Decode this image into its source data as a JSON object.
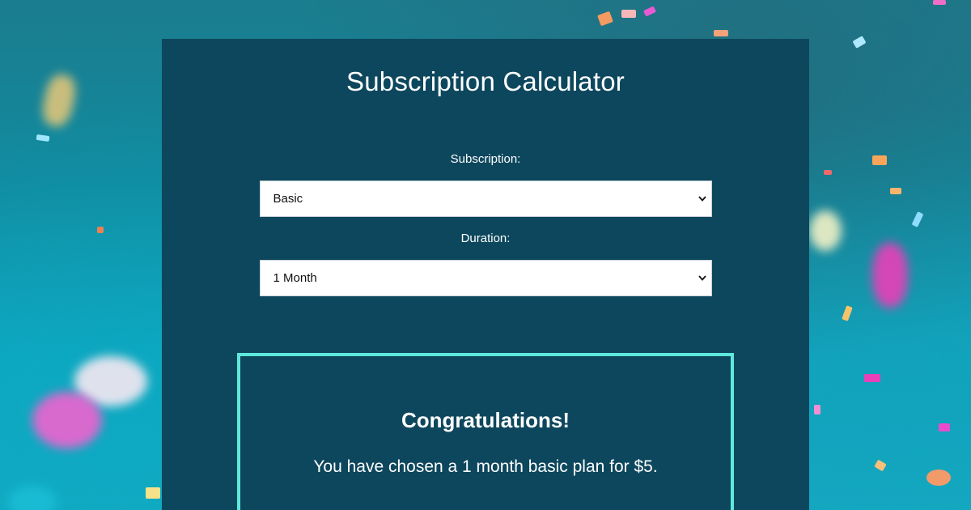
{
  "page": {
    "title": "Subscription Calculator"
  },
  "form": {
    "subscription_label": "Subscription:",
    "subscription_value": "Basic",
    "duration_label": "Duration:",
    "duration_value": "1 Month"
  },
  "result": {
    "heading": "Congratulations!",
    "message": "You have chosen a 1 month basic plan for $5."
  },
  "colors": {
    "panel": "#0d475d",
    "result_border": "#5ee8dd",
    "background": "#12899d"
  },
  "icons": {
    "select_caret": "chevron-down-icon"
  }
}
